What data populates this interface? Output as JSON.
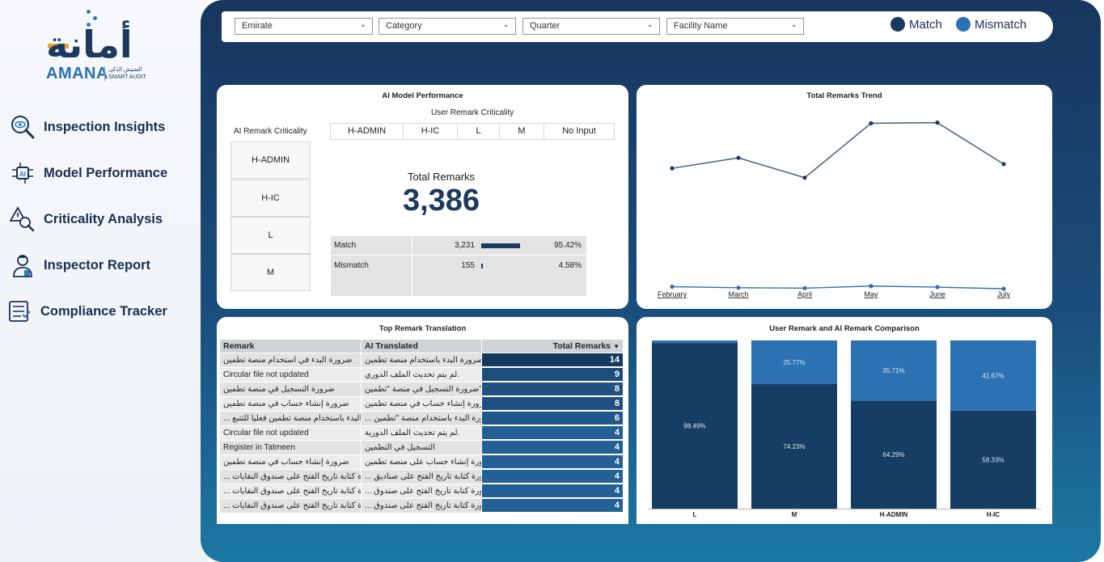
{
  "brand": {
    "arabic_name": "أمانة",
    "english_name": "AMANA",
    "arabic_tagline": "التفتيش الذكي",
    "english_tagline": "SMART AUDIT"
  },
  "nav": {
    "items": [
      {
        "label": "Inspection Insights",
        "icon": "magnifier-eye-icon"
      },
      {
        "label": "Model Performance",
        "icon": "ai-chip-icon"
      },
      {
        "label": "Criticality Analysis",
        "icon": "warning-magnifier-icon"
      },
      {
        "label": "Inspector Report",
        "icon": "inspector-person-icon"
      },
      {
        "label": "Compliance Tracker",
        "icon": "checklist-icon"
      }
    ]
  },
  "filters": {
    "emirate": "Emirate",
    "category": "Category",
    "quarter": "Quarter",
    "facility": "Facility Name"
  },
  "legend": {
    "match": "Match",
    "mismatch": "Mismatch",
    "match_color": "#1a3a5f",
    "mismatch_color": "#2c72b3"
  },
  "model_performance": {
    "title": "AI Model Performance",
    "user_header": "User Remark Criticality",
    "ai_header": "AI Remark Criticality",
    "columns": [
      "H-ADMIN",
      "H-IC",
      "L",
      "M",
      "No Input"
    ],
    "rows": [
      "H-ADMIN",
      "H-IC",
      "L",
      "M"
    ],
    "kpi_label": "Total Remarks",
    "kpi_value": "3,386",
    "breakdown": [
      {
        "label": "Match",
        "count": "3,231",
        "pct": "95.42%",
        "share": 0.9542
      },
      {
        "label": "Mismatch",
        "count": "155",
        "pct": "4.58%",
        "share": 0.0458
      }
    ]
  },
  "chart_data": [
    {
      "type": "line",
      "title": "Total Remarks Trend",
      "categories": [
        "February",
        "March",
        "April",
        "May",
        "June",
        "July"
      ],
      "series": [
        {
          "name": "Match",
          "values": [
            590,
            640,
            545,
            805,
            808,
            610
          ]
        },
        {
          "name": "Mismatch",
          "values": [
            25,
            20,
            18,
            28,
            23,
            15
          ]
        }
      ],
      "ylim": [
        0,
        880
      ],
      "grid": false
    },
    {
      "type": "bar",
      "title": "User Remark and AI Remark Comparison",
      "categories": [
        "L",
        "M",
        "H-ADMIN",
        "H-IC"
      ],
      "series": [
        {
          "name": "Match",
          "values": [
            98.49,
            74.23,
            64.29,
            58.33
          ],
          "labels": [
            "98.49%",
            "74.23%",
            "64.29%",
            "58.33%"
          ]
        },
        {
          "name": "Mismatch",
          "values": [
            1.51,
            25.77,
            35.71,
            41.67
          ],
          "labels": [
            "",
            "25.77%",
            "35.71%",
            "41.67%"
          ]
        }
      ],
      "stacked": true,
      "ylim": [
        0,
        100
      ]
    }
  ],
  "translation": {
    "title": "Top Remark Translation",
    "headers": {
      "remark": "Remark",
      "ai": "AI Translated",
      "total": "Total Remarks",
      "sort_icon": "▼"
    },
    "max_total": 14,
    "rows": [
      {
        "remark": "ضرورة البدء في استخدام منصة تطمين",
        "ai": "ضرورة البدء باستخدام منصة تطمين",
        "total": 14
      },
      {
        "remark": "Circular file not updated",
        "ai": "لم يتم تحديث الملف الدوري.",
        "total": 9
      },
      {
        "remark": "ضرورة التسجيل في منصة تطمين",
        "ai": "ضرورة التسجيل في منصة \"تطمين\".",
        "total": 8
      },
      {
        "remark": "ضرورة إنشاء حساب في منصة تطمين",
        "ai": "ضرورة إنشاء حساب في منصة تطمين",
        "total": 8
      },
      {
        "remark": "... ضرورة البدء باستخدام منصة تطمين فعليا للتتبع",
        "ai": "... ضرورة البدء باستخدام منصة \"تطمين",
        "total": 6
      },
      {
        "remark": "Circular file not updated",
        "ai": "لم يتم تحديث الملف الدورية.",
        "total": 4
      },
      {
        "remark": "Register in Tatmeen",
        "ai": "التسجيل في التطمين",
        "total": 4
      },
      {
        "remark": "ضرورة إنشاء حساب في منصة تطمين",
        "ai": "ضرورة إنشاء حساب على منصة تطمين",
        "total": 4
      },
      {
        "remark": "... ضرورة كتابة تاريخ الفتح على صندوق النفايات",
        "ai": "... ضرورة كتابة تاريخ الفتح على صناديق",
        "total": 4
      },
      {
        "remark": "... ضرورة كتابة تاريخ الفتح على صندوق النفايات",
        "ai": "... ضرورة كتابة تاريخ الفتح على صندوق",
        "total": 4
      },
      {
        "remark": "... ضرورة كتابة تاريخ الفتح على صندوق النفايات",
        "ai": "... ضرورة كتابة تاريخ الفتح على صندوق",
        "total": 4
      }
    ]
  }
}
